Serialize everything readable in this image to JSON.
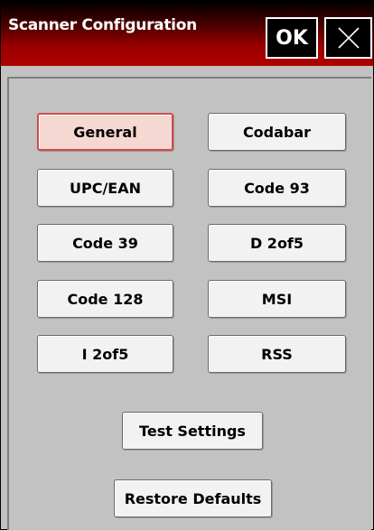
{
  "window": {
    "title": "Scanner Configuration",
    "ok_label": "OK",
    "close_icon": "close-icon"
  },
  "buttons": {
    "general": "General",
    "codabar": "Codabar",
    "upc_ean": "UPC/EAN",
    "code93": "Code 93",
    "code39": "Code 39",
    "d2of5": "D 2of5",
    "code128": "Code 128",
    "msi": "MSI",
    "i2of5": "I 2of5",
    "rss": "RSS",
    "test_settings": "Test Settings",
    "restore_defaults": "Restore Defaults"
  },
  "state": {
    "selected_button": "General"
  },
  "colors": {
    "titlebar_red": "#b00000",
    "selected_border": "#d34a4a",
    "selected_fill": "#f6d8d2",
    "panel_gray": "#c2c2c2"
  }
}
